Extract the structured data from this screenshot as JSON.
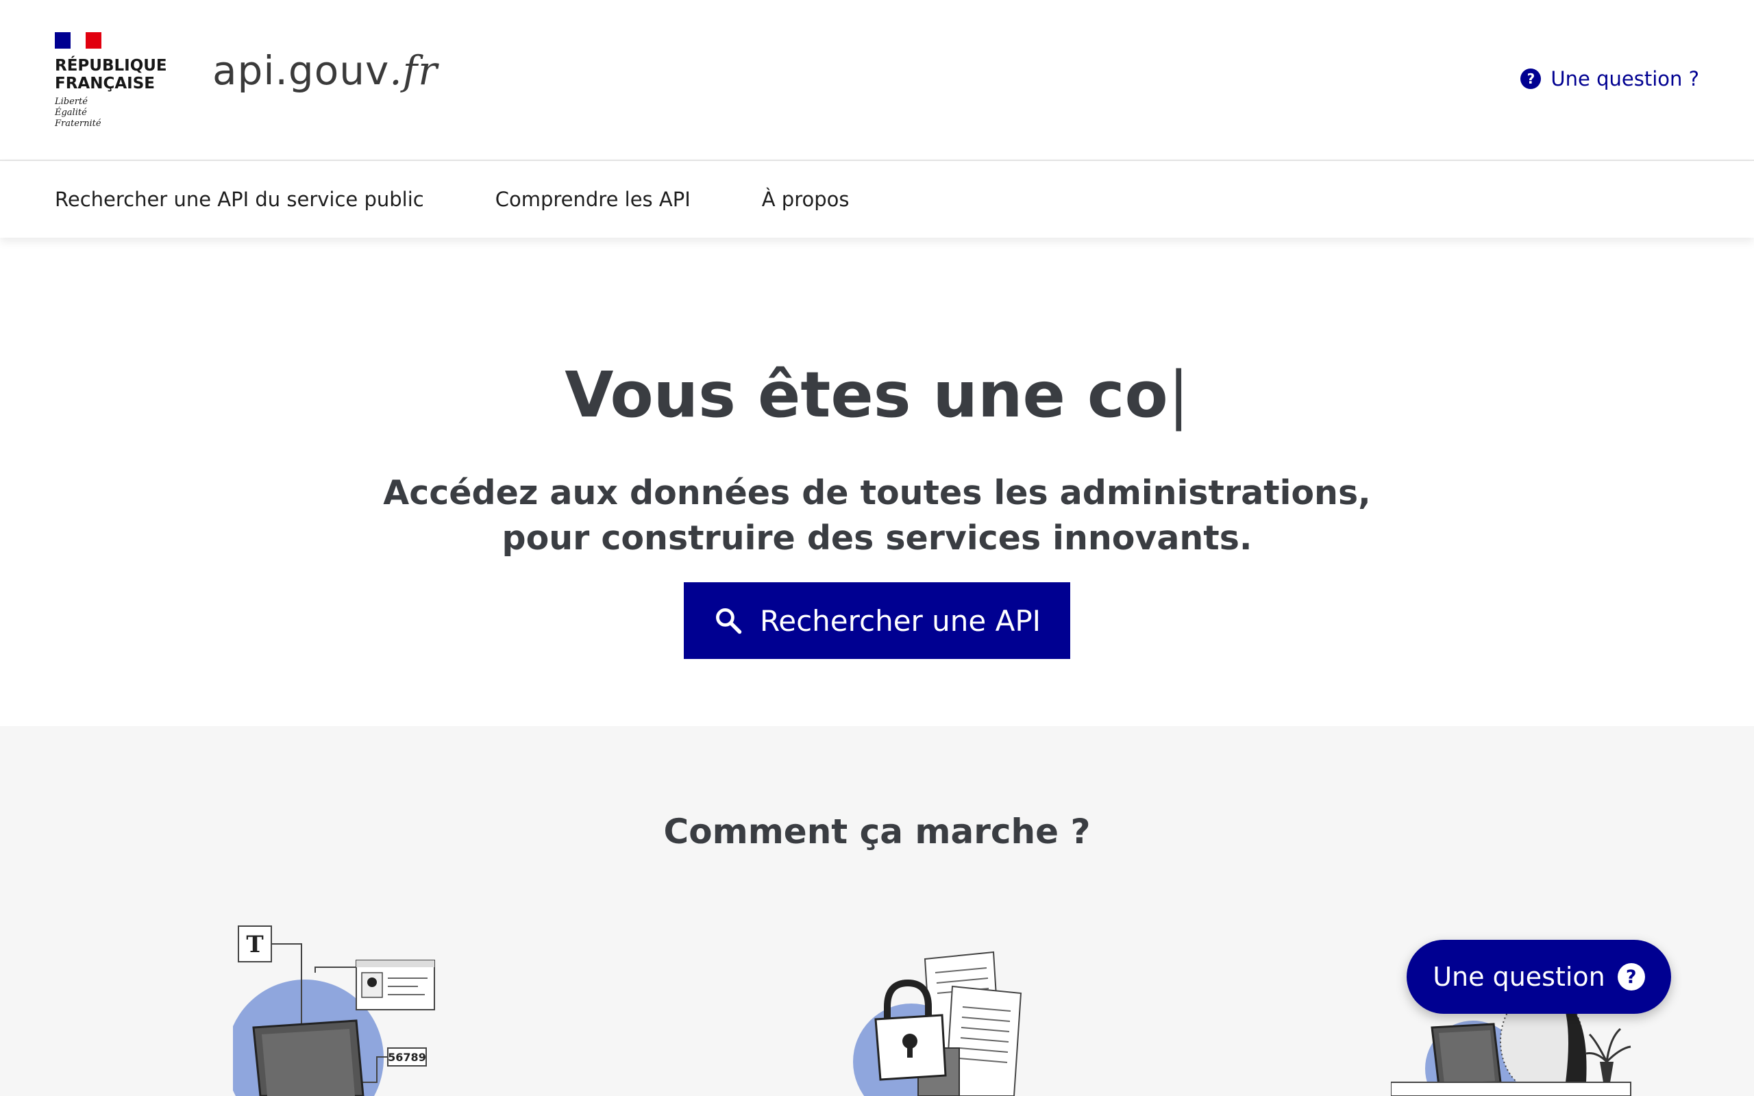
{
  "header": {
    "republique_line1": "RÉPUBLIQUE",
    "republique_line2": "FRANÇAISE",
    "motto_1": "Liberté",
    "motto_2": "Égalité",
    "motto_3": "Fraternité",
    "site_name": "api.gouv",
    "site_tld": ".fr",
    "question_link": "Une question ?"
  },
  "nav": {
    "items": [
      {
        "label": "Rechercher une API du service public"
      },
      {
        "label": "Comprendre les API"
      },
      {
        "label": "À propos"
      }
    ]
  },
  "hero": {
    "title": "Vous êtes une co",
    "caret": "|",
    "subtitle_line1": "Accédez aux données de toutes les administrations,",
    "subtitle_line2": "pour construire des services innovants.",
    "search_button": "Rechercher une API"
  },
  "how": {
    "title": "Comment ça marche ?",
    "illus1_letter": "T",
    "illus1_number": "56789"
  },
  "floating": {
    "question_label": "Une question"
  },
  "colors": {
    "primary": "#000091",
    "text": "#3a3d42",
    "section_bg": "#f6f6f6",
    "flag_red": "#e1000f"
  }
}
